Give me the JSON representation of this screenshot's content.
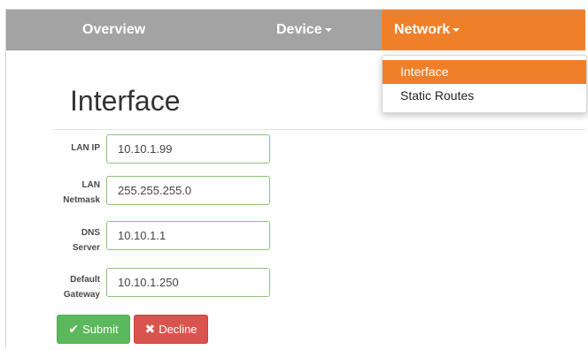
{
  "navbar": {
    "items": [
      {
        "label": "Overview",
        "has_caret": false
      },
      {
        "label": "Device",
        "has_caret": true
      },
      {
        "label": "Network",
        "has_caret": true,
        "active": true
      }
    ]
  },
  "dropdown": {
    "items": [
      {
        "label": "Interface",
        "active": true
      },
      {
        "label": "Static Routes",
        "active": false
      }
    ]
  },
  "page": {
    "title": "Interface"
  },
  "form": {
    "fields": [
      {
        "label_line1": "LAN IP",
        "label_line2": "",
        "value": "10.10.1.99"
      },
      {
        "label_line1": "LAN",
        "label_line2": "Netmask",
        "value": "255.255.255.0"
      },
      {
        "label_line1": "DNS",
        "label_line2": "Server",
        "value": "10.10.1.1"
      },
      {
        "label_line1": "Default",
        "label_line2": "Gateway",
        "value": "10.10.1.250"
      }
    ],
    "submit_label": "Submit",
    "decline_label": "Decline"
  },
  "colors": {
    "navbar": "#a3a3a3",
    "accent": "#f07f2a",
    "submit": "#5cb85c",
    "decline": "#d9534f",
    "input_border": "#8cc57a"
  },
  "icons": {
    "submit": "check-icon",
    "decline": "x-icon"
  }
}
